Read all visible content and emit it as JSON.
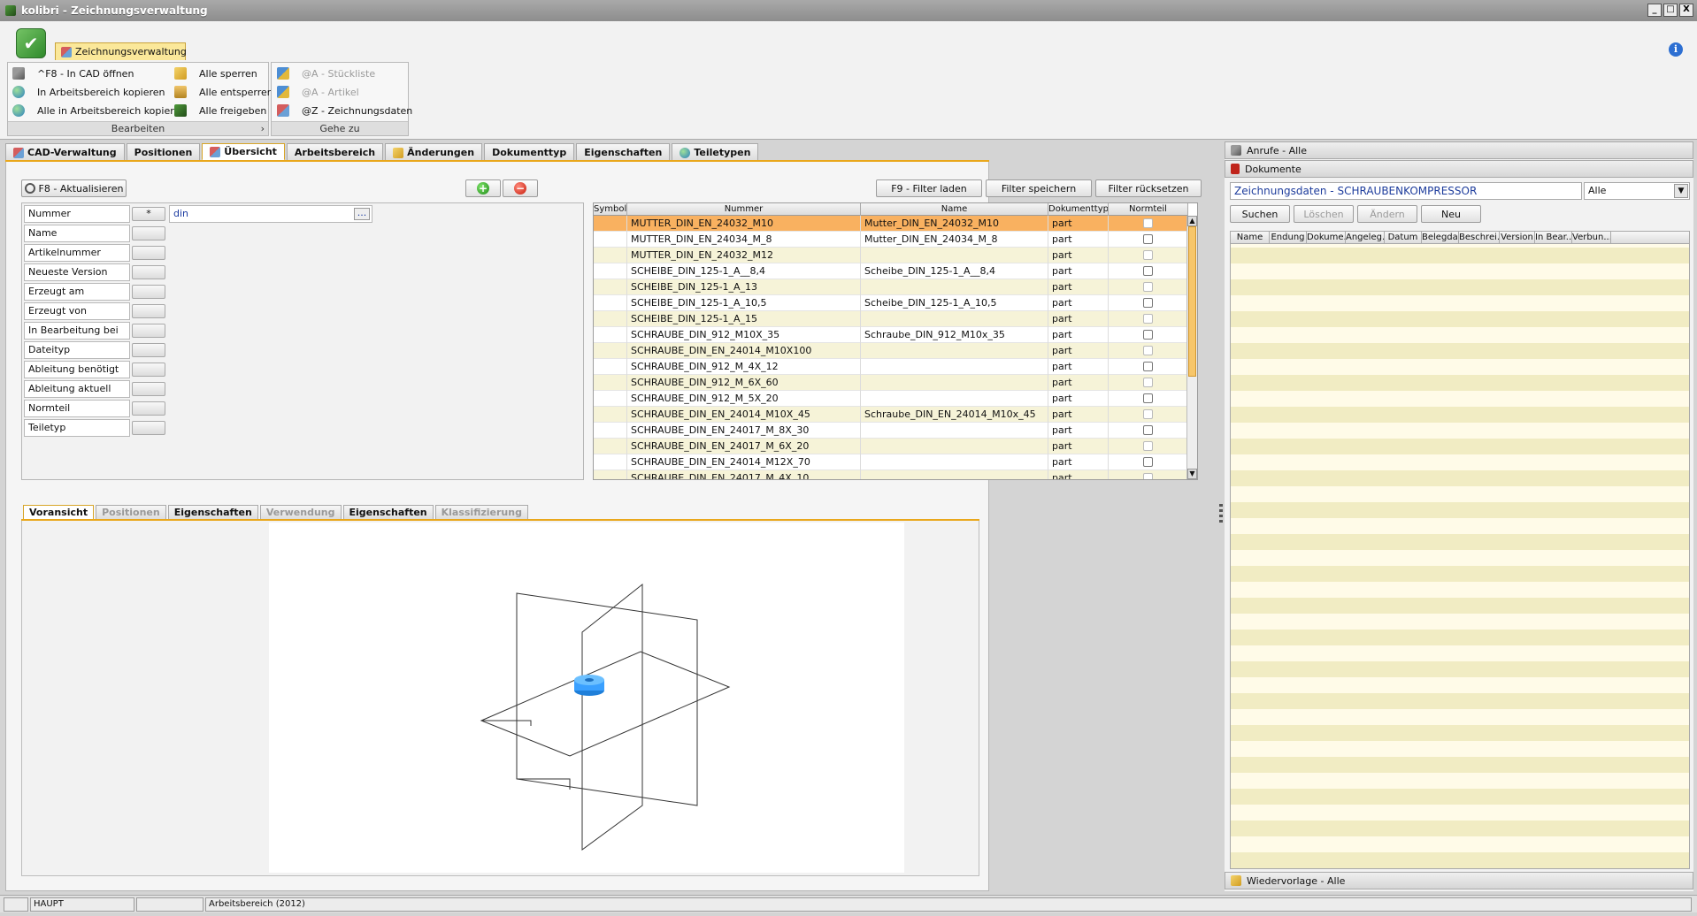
{
  "window": {
    "title": "kolibri - Zeichnungsverwaltung",
    "minimize": "_",
    "maximize": "□",
    "close": "X"
  },
  "ribbon": {
    "tab_label": "Zeichnungsverwaltung",
    "groups": [
      {
        "caption": "Bearbeiten",
        "expand": "›",
        "items": [
          {
            "label": "^F8 - In CAD öffnen",
            "icon": "tools-icon"
          },
          {
            "label": "In Arbeitsbereich kopieren",
            "icon": "globe-icon"
          },
          {
            "label": "Alle in Arbeitsbereich kopieren",
            "icon": "globe-icon"
          },
          {
            "label": "Alle sperren",
            "icon": "tag-icon"
          },
          {
            "label": "Alle entsperren",
            "icon": "lock-icon"
          },
          {
            "label": "Alle freigeben",
            "icon": "arrow-icon"
          }
        ]
      },
      {
        "caption": "Gehe zu",
        "items": [
          {
            "label": "@A - Stückliste",
            "icon": "boxes-icon",
            "disabled": true
          },
          {
            "label": "@A - Artikel",
            "icon": "boxes-icon",
            "disabled": true
          },
          {
            "label": "@Z - Zeichnungsdaten",
            "icon": "db-icon",
            "disabled": false
          }
        ]
      }
    ]
  },
  "tabs": [
    {
      "label": "CAD-Verwaltung",
      "icon": true
    },
    {
      "label": "Positionen",
      "icon": false
    },
    {
      "label": "Übersicht",
      "icon": true,
      "active": true
    },
    {
      "label": "Arbeitsbereich",
      "icon": false
    },
    {
      "label": "Änderungen",
      "icon": true
    },
    {
      "label": "Dokumenttyp",
      "icon": false
    },
    {
      "label": "Eigenschaften",
      "icon": false
    },
    {
      "label": "Teiletypen",
      "icon": true
    }
  ],
  "toolbar": {
    "refresh": "F8 - Aktualisieren",
    "add": "+",
    "remove": "−",
    "load_filter": "F9 - Filter laden",
    "save_filter": "Filter speichern",
    "reset_filter": "Filter rücksetzen"
  },
  "filter": {
    "rows": [
      {
        "label": "Nummer",
        "op": "*",
        "value": "din",
        "more": "..."
      },
      {
        "label": "Name"
      },
      {
        "label": "Artikelnummer"
      },
      {
        "label": "Neueste Version"
      },
      {
        "label": "Erzeugt am"
      },
      {
        "label": "Erzeugt von"
      },
      {
        "label": "In Bearbeitung bei"
      },
      {
        "label": "Dateityp"
      },
      {
        "label": "Ableitung benötigt"
      },
      {
        "label": "Ableitung aktuell"
      },
      {
        "label": "Normteil"
      },
      {
        "label": "Teiletyp"
      }
    ]
  },
  "grid": {
    "columns": [
      "Symbol",
      "Nummer",
      "Name",
      "Dokumenttyp",
      "Normteil"
    ],
    "rows": [
      {
        "nummer": "MUTTER_DIN_EN_24032_M10",
        "name": "Mutter_DIN_EN_24032_M10",
        "typ": "part",
        "sel": true
      },
      {
        "nummer": "MUTTER_DIN_EN_24034_M_8",
        "name": "Mutter_DIN_EN_24034_M_8",
        "typ": "part"
      },
      {
        "nummer": "MUTTER_DIN_EN_24032_M12",
        "name": "",
        "typ": "part"
      },
      {
        "nummer": "SCHEIBE_DIN_125-1_A__8,4",
        "name": "Scheibe_DIN_125-1_A__8,4",
        "typ": "part"
      },
      {
        "nummer": "SCHEIBE_DIN_125-1_A_13",
        "name": "",
        "typ": "part"
      },
      {
        "nummer": "SCHEIBE_DIN_125-1_A_10,5",
        "name": "Scheibe_DIN_125-1_A_10,5",
        "typ": "part"
      },
      {
        "nummer": "SCHEIBE_DIN_125-1_A_15",
        "name": "",
        "typ": "part"
      },
      {
        "nummer": "SCHRAUBE_DIN_912_M10X_35",
        "name": "Schraube_DIN_912_M10x_35",
        "typ": "part"
      },
      {
        "nummer": "SCHRAUBE_DIN_EN_24014_M10X100",
        "name": "",
        "typ": "part"
      },
      {
        "nummer": "SCHRAUBE_DIN_912_M_4X_12",
        "name": "",
        "typ": "part"
      },
      {
        "nummer": "SCHRAUBE_DIN_912_M_6X_60",
        "name": "",
        "typ": "part"
      },
      {
        "nummer": "SCHRAUBE_DIN_912_M_5X_20",
        "name": "",
        "typ": "part"
      },
      {
        "nummer": "SCHRAUBE_DIN_EN_24014_M10X_45",
        "name": "Schraube_DIN_EN_24014_M10x_45",
        "typ": "part"
      },
      {
        "nummer": "SCHRAUBE_DIN_EN_24017_M_8X_30",
        "name": "",
        "typ": "part"
      },
      {
        "nummer": "SCHRAUBE_DIN_EN_24017_M_6X_20",
        "name": "",
        "typ": "part"
      },
      {
        "nummer": "SCHRAUBE_DIN_EN_24014_M12X_70",
        "name": "",
        "typ": "part"
      },
      {
        "nummer": "SCHRAUBE_DIN_EN_24017_M_4X_10",
        "name": "",
        "typ": "part"
      }
    ]
  },
  "bottom_tabs": [
    {
      "label": "Voransicht",
      "active": true
    },
    {
      "label": "Positionen",
      "disabled": true
    },
    {
      "label": "Eigenschaften"
    },
    {
      "label": "Verwendung",
      "disabled": true
    },
    {
      "label": "Eigenschaften"
    },
    {
      "label": "Klassifizierung",
      "disabled": true
    }
  ],
  "right": {
    "calls": "Anrufe - Alle",
    "documents": "Dokumente",
    "context": "Zeichnungsdaten - SCHRAUBENKOMPRESSOR",
    "filter_value": "Alle",
    "buttons": {
      "search": "Suchen",
      "delete": "Löschen",
      "edit": "Ändern",
      "new": "Neu"
    },
    "columns": [
      "Name",
      "Endung",
      "Dokume...",
      "Angeleg...",
      "Datum",
      "Belegda...",
      "Beschrei...",
      "Version",
      "In Bear...",
      "Verbun..."
    ],
    "resubmission": "Wiedervorlage - Alle"
  },
  "status": {
    "module": "HAUPT",
    "workspace": "Arbeitsbereich (2012)"
  }
}
